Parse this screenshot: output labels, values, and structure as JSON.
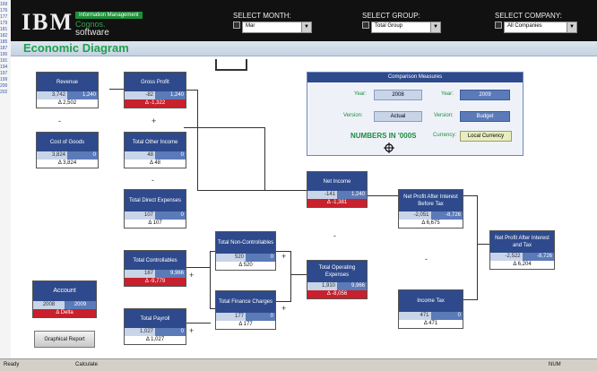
{
  "left_strip": [
    "169",
    "176",
    "177",
    "179",
    "181",
    "182",
    "185",
    "187",
    "190",
    "191",
    "194",
    "197",
    "199",
    "200",
    "202"
  ],
  "header": {
    "brand": "IBM",
    "badge": "Information Management",
    "cognos": "Cognos.",
    "software": "software",
    "month": {
      "label": "SELECT MONTH:",
      "value": "Mar"
    },
    "group": {
      "label": "SELECT GROUP:",
      "value": "Total Group"
    },
    "company": {
      "label": "SELECT COMPANY:",
      "value": "All Companies"
    }
  },
  "page_title": "Economic Diagram",
  "comparison": {
    "title": "Comparison Measures",
    "year_label": "Year:",
    "year_a": "2008",
    "year_b": "2009",
    "version_label": "Version:",
    "version_a": "Actual",
    "version_b": "Budget",
    "numbers_text": "NUMBERS IN '000S",
    "currency_label": "Currency:",
    "currency_value": "Local Currency"
  },
  "nodes": {
    "revenue": {
      "title": "Revenue",
      "a": "3,742",
      "b": "1,240",
      "delta": "Δ 2,502"
    },
    "cost_goods": {
      "title": "Cost of Goods",
      "a": "3,824",
      "b": "0",
      "delta": "Δ 3,824"
    },
    "gross_profit": {
      "title": "Gross Profit",
      "a": "-82",
      "b": "1,240",
      "delta": "Δ -1,322"
    },
    "total_other_income": {
      "title": "Total Other Income",
      "a": "48",
      "b": "0",
      "delta": "Δ 48"
    },
    "total_direct_expenses": {
      "title": "Total Direct Expenses",
      "a": "107",
      "b": "0",
      "delta": "Δ 107"
    },
    "total_controllables": {
      "title": "Total Controllables",
      "a": "187",
      "b": "9,966",
      "delta": "Δ -9,779"
    },
    "total_payroll": {
      "title": "Total Payroll",
      "a": "1,027",
      "b": "0",
      "delta": "Δ 1,027"
    },
    "total_non_controllables": {
      "title": "Total Non-Controllables",
      "a": "520",
      "b": "0",
      "delta": "Δ 520"
    },
    "total_finance_charges": {
      "title": "Total Finance Charges",
      "a": "177",
      "b": "0",
      "delta": "Δ 177"
    },
    "net_income": {
      "title": "Net Income",
      "a": "-141",
      "b": "1,240",
      "delta": "Δ -1,381"
    },
    "total_operating_expenses": {
      "title": "Total Operating Expenses",
      "a": "1,910",
      "b": "9,966",
      "delta": "Δ -8,056"
    },
    "npa_before_tax": {
      "title": "Net Profit After Interest Before Tax",
      "a": "-2,051",
      "b": "-8,726",
      "delta": "Δ 6,675"
    },
    "income_tax": {
      "title": "Income Tax",
      "a": "471",
      "b": "0",
      "delta": "Δ 471"
    },
    "npa_and_tax": {
      "title": "Net Profit After Interest and Tax",
      "a": "-2,522",
      "b": "-8,726",
      "delta": "Δ 6,204"
    },
    "account": {
      "title": "Account",
      "a": "2008",
      "b": "2009",
      "delta": "Δ Delta"
    }
  },
  "operators": {
    "minus": "-",
    "plus": "+"
  },
  "graphical_report": "Graphical Report",
  "status": {
    "ready": "Ready",
    "calculate": "Calculate",
    "num": "NUM"
  },
  "colors": {
    "header_blue": "#2e4a8c",
    "accent_green": "#1e8a3e",
    "delta_red": "#c8202c"
  }
}
